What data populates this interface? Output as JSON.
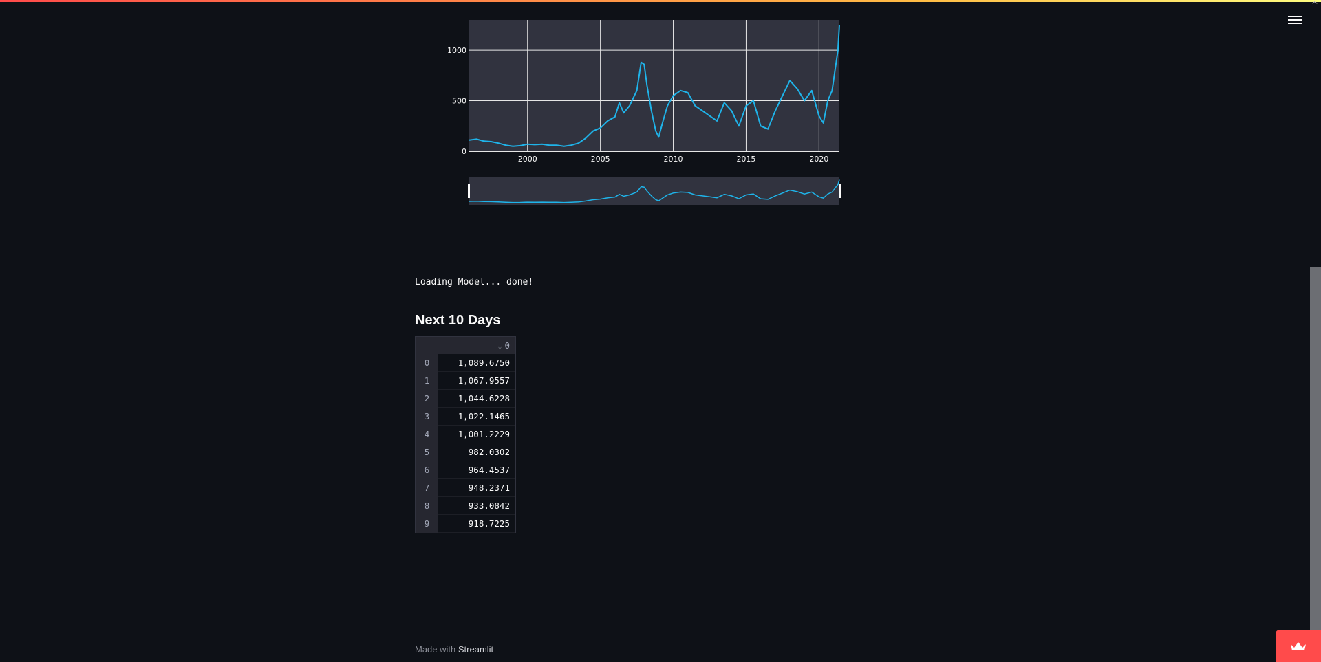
{
  "chart_data": {
    "type": "line",
    "x_ticks": [
      "2000",
      "2005",
      "2010",
      "2015",
      "2020"
    ],
    "y_ticks": [
      "0",
      "500",
      "1000"
    ],
    "ylim": [
      0,
      1300
    ],
    "xlim": [
      1996,
      2021.4
    ],
    "grid": true,
    "range_slider": true,
    "series": [
      {
        "color": "#1fb4ea",
        "x": [
          1996.0,
          1996.5,
          1997.0,
          1997.5,
          1998.0,
          1998.5,
          1999.0,
          1999.5,
          2000.0,
          2000.5,
          2001.0,
          2001.5,
          2002.0,
          2002.5,
          2003.0,
          2003.5,
          2004.0,
          2004.5,
          2005.0,
          2005.5,
          2006.0,
          2006.3,
          2006.6,
          2007.0,
          2007.5,
          2007.8,
          2008.0,
          2008.2,
          2008.5,
          2008.8,
          2009.0,
          2009.3,
          2009.6,
          2010.0,
          2010.5,
          2011.0,
          2011.5,
          2012.0,
          2012.5,
          2013.0,
          2013.5,
          2014.0,
          2014.5,
          2015.0,
          2015.5,
          2016.0,
          2016.5,
          2017.0,
          2017.5,
          2018.0,
          2018.5,
          2019.0,
          2019.5,
          2020.0,
          2020.3,
          2020.6,
          2020.9,
          2021.1,
          2021.3,
          2021.4
        ],
        "y": [
          110,
          120,
          100,
          95,
          80,
          60,
          50,
          55,
          70,
          65,
          70,
          60,
          60,
          50,
          60,
          80,
          130,
          200,
          230,
          300,
          340,
          480,
          380,
          450,
          600,
          880,
          860,
          650,
          400,
          200,
          140,
          300,
          450,
          550,
          600,
          580,
          450,
          400,
          350,
          300,
          480,
          400,
          250,
          450,
          500,
          250,
          220,
          400,
          550,
          700,
          620,
          500,
          600,
          350,
          280,
          500,
          600,
          800,
          1000,
          1250
        ]
      }
    ]
  },
  "status": {
    "loading": "Loading Model... done!"
  },
  "section": {
    "title": "Next 10 Days"
  },
  "table": {
    "column": "0",
    "rows": [
      {
        "index": "0",
        "value": "1,089.6750"
      },
      {
        "index": "1",
        "value": "1,067.9557"
      },
      {
        "index": "2",
        "value": "1,044.6228"
      },
      {
        "index": "3",
        "value": "1,022.1465"
      },
      {
        "index": "4",
        "value": "1,001.2229"
      },
      {
        "index": "5",
        "value": "982.0302"
      },
      {
        "index": "6",
        "value": "964.4537"
      },
      {
        "index": "7",
        "value": "948.2371"
      },
      {
        "index": "8",
        "value": "933.0842"
      },
      {
        "index": "9",
        "value": "918.7225"
      }
    ]
  },
  "footer": {
    "prefix": "Made with",
    "link": "Streamlit"
  },
  "icons": {
    "menu": "hamburger-icon",
    "crown": "crown-icon",
    "scroll_up": "chevron-up-icon"
  },
  "colors": {
    "background": "#0e1117",
    "accent": "#ff4b4b",
    "line": "#1fb4ea"
  }
}
